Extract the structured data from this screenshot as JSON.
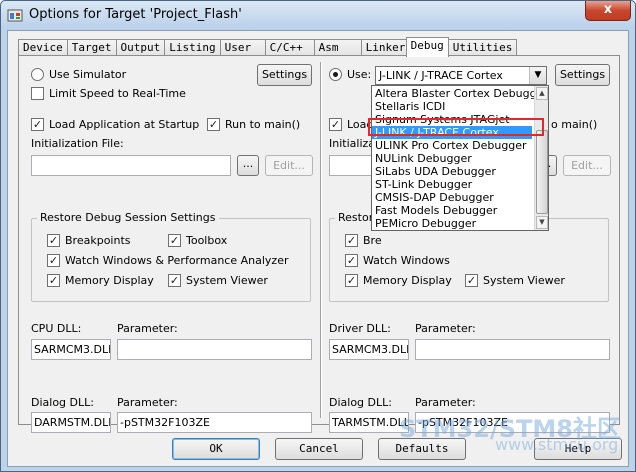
{
  "window": {
    "title": "Options for Target 'Project_Flash'",
    "close_glyph": "x"
  },
  "tabs": [
    {
      "label": "Device"
    },
    {
      "label": "Target"
    },
    {
      "label": "Output"
    },
    {
      "label": "Listing"
    },
    {
      "label": "User"
    },
    {
      "label": "C/C++"
    },
    {
      "label": "Asm"
    },
    {
      "label": "Linker"
    },
    {
      "label": "Debug"
    },
    {
      "label": "Utilities"
    }
  ],
  "active_tab": "Debug",
  "left": {
    "use_simulator": "Use Simulator",
    "limit_speed": "Limit Speed to Real-Time",
    "settings": "Settings",
    "load_app": "Load Application at Startup",
    "run_to_main": "Run to main()",
    "init_file_label": "Initialization File:",
    "init_file_value": "",
    "browse": "...",
    "edit": "Edit...",
    "restore_legend": "Restore Debug Session Settings",
    "breakpoints": "Breakpoints",
    "toolbox": "Toolbox",
    "watch_windows": "Watch Windows & Performance Analyzer",
    "memory_display": "Memory Display",
    "system_viewer": "System Viewer",
    "cpu_dll_label": "CPU DLL:",
    "cpu_param_label": "Parameter:",
    "cpu_dll": "SARMCM3.DLL",
    "cpu_param": "",
    "dialog_dll_label": "Dialog DLL:",
    "dialog_param_label": "Parameter:",
    "dialog_dll": "DARMSTM.DLL",
    "dialog_param": "-pSTM32F103ZE"
  },
  "right": {
    "use": "Use:",
    "selected_debugger": "J-LINK / J-TRACE Cortex",
    "settings": "Settings",
    "load_partial": "Load",
    "run_partial": "o main()",
    "init_partial": "Initializati",
    "browse": "...",
    "edit": "Edit...",
    "restore_partial": "Restore",
    "breakpoints_partial": "Bre",
    "watch_windows": "Watch Windows",
    "memory_display": "Memory Display",
    "system_viewer": "System Viewer",
    "driver_dll_label": "Driver DLL:",
    "driver_param_label": "Parameter:",
    "driver_dll": "SARMCM3.DLL",
    "driver_param": "",
    "dialog_dll_label": "Dialog DLL:",
    "dialog_param_label": "Parameter:",
    "dialog_dll": "TARMSTM.DLL",
    "dialog_param": "-pSTM32F103ZE"
  },
  "dropdown": {
    "items": [
      "Altera Blaster Cortex Debugger",
      "Stellaris ICDI",
      "Signum Systems JTAGjet",
      "J-LINK / J-TRACE Cortex",
      "ULINK Pro Cortex Debugger",
      "NULink Debugger",
      "SiLabs UDA Debugger",
      "ST-Link Debugger",
      "CMSIS-DAP Debugger",
      "Fast Models Debugger",
      "PEMicro Debugger"
    ],
    "selected_index": 3
  },
  "buttons": {
    "ok": "OK",
    "cancel": "Cancel",
    "defaults": "Defaults",
    "help": "Help"
  },
  "watermark": {
    "line1": "STM32/STM8社区",
    "line2": "www.stmcu.org"
  },
  "checkbox_glyph": "✓",
  "arrow_glyph": "▼",
  "scroll_up_glyph": "▲",
  "scroll_down_glyph": "▼",
  "colors": {
    "selection": "#3399ff",
    "highlight_box": "#e02a2a",
    "title_bar": "#b9d1ea",
    "close_button": "#c8482f"
  }
}
